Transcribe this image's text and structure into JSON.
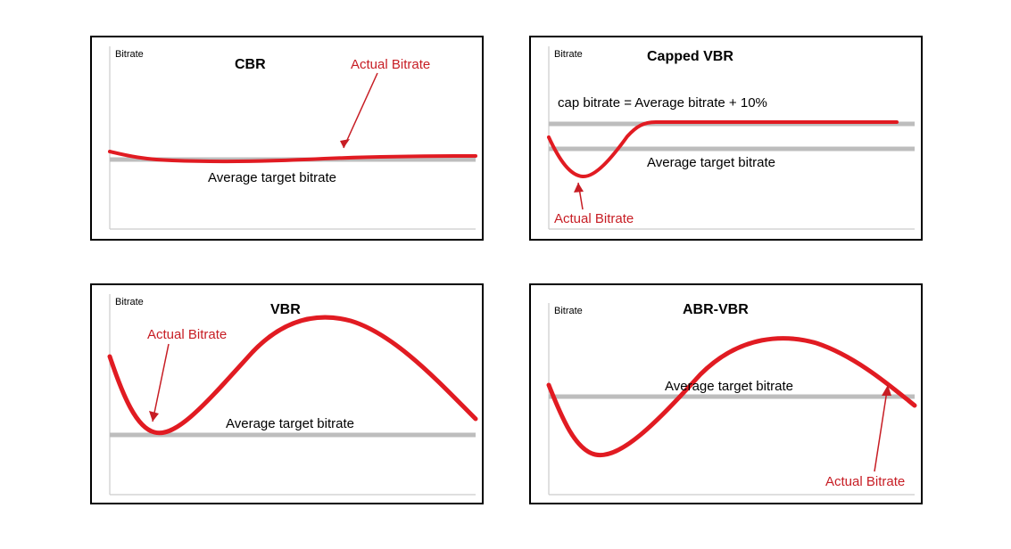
{
  "chart_data": [
    {
      "id": "cbr",
      "type": "line",
      "title": "CBR",
      "ylabel": "Bitrate",
      "xlabel": "",
      "ylim": [
        0,
        100
      ],
      "series": [
        {
          "name": "Average target bitrate",
          "kind": "reference-line",
          "y": 46
        },
        {
          "name": "Actual Bitrate",
          "kind": "curve",
          "x": [
            0,
            5,
            12,
            20,
            30,
            40,
            50,
            60,
            70,
            80,
            90,
            100
          ],
          "values": [
            50,
            47,
            45,
            44,
            44,
            44.5,
            45,
            45.5,
            46,
            46,
            46,
            46
          ]
        }
      ],
      "annotations": [
        {
          "text": "Actual Bitrate",
          "target": "actual",
          "color": "red"
        },
        {
          "text": "Average target bitrate",
          "target": "reference"
        }
      ]
    },
    {
      "id": "capped_vbr",
      "type": "line",
      "title": "Capped VBR",
      "ylabel": "Bitrate",
      "xlabel": "",
      "ylim": [
        0,
        100
      ],
      "series": [
        {
          "name": "Average target bitrate",
          "kind": "reference-line",
          "y": 44
        },
        {
          "name": "cap bitrate = Average bitrate + 10%",
          "kind": "reference-line",
          "y": 56
        },
        {
          "name": "Actual Bitrate",
          "kind": "curve",
          "x": [
            0,
            4,
            8,
            12,
            16,
            20,
            24,
            28,
            30,
            95
          ],
          "values": [
            50,
            38,
            32,
            31,
            34,
            42,
            50,
            55,
            56,
            56
          ]
        }
      ],
      "annotations": [
        {
          "text": "cap bitrate = Average bitrate + 10%",
          "target": "cap"
        },
        {
          "text": "Average target bitrate",
          "target": "reference"
        },
        {
          "text": "Actual Bitrate",
          "target": "actual",
          "color": "red"
        }
      ]
    },
    {
      "id": "vbr",
      "type": "line",
      "title": "VBR",
      "ylabel": "Bitrate",
      "xlabel": "",
      "ylim": [
        0,
        100
      ],
      "series": [
        {
          "name": "Average target bitrate",
          "kind": "reference-line",
          "y": 32
        },
        {
          "name": "Actual Bitrate",
          "kind": "curve",
          "x": [
            0,
            5,
            10,
            15,
            20,
            30,
            40,
            50,
            55,
            60,
            70,
            80,
            90,
            100
          ],
          "values": [
            65,
            45,
            35,
            32,
            34,
            48,
            68,
            82,
            84,
            83,
            75,
            62,
            49,
            40
          ]
        }
      ],
      "annotations": [
        {
          "text": "Actual Bitrate",
          "target": "actual",
          "color": "red"
        },
        {
          "text": "Average target bitrate",
          "target": "reference"
        }
      ]
    },
    {
      "id": "abr_vbr",
      "type": "line",
      "title": "ABR-VBR",
      "ylabel": "Bitrate",
      "xlabel": "",
      "ylim": [
        0,
        100
      ],
      "series": [
        {
          "name": "Average target bitrate",
          "kind": "reference-line",
          "y": 50
        },
        {
          "name": "Actual Bitrate",
          "kind": "curve",
          "x": [
            0,
            5,
            10,
            15,
            20,
            30,
            40,
            50,
            60,
            65,
            70,
            80,
            90,
            100
          ],
          "values": [
            56,
            40,
            28,
            22,
            22,
            32,
            50,
            66,
            74,
            75,
            74,
            68,
            58,
            48
          ]
        }
      ],
      "annotations": [
        {
          "text": "Average target bitrate",
          "target": "reference"
        },
        {
          "text": "Actual Bitrate",
          "target": "actual",
          "color": "red"
        }
      ]
    }
  ],
  "labels": {
    "axis_bitrate": "Bitrate",
    "actual_bitrate": "Actual Bitrate",
    "avg_target": "Average target bitrate",
    "cap_formula": "cap bitrate = Average bitrate + 10%"
  },
  "titles": {
    "cbr": "CBR",
    "capped_vbr": "Capped VBR",
    "vbr": "VBR",
    "abr_vbr": "ABR-VBR"
  },
  "colors": {
    "actual": "#e11b22",
    "target": "#bdbdbd",
    "axis": "#cccccc",
    "arrow": "#c71d24",
    "text_red": "#c71d24"
  }
}
